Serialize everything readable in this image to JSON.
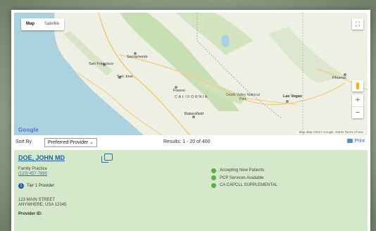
{
  "map": {
    "type_options": [
      "Map",
      "Satellite"
    ],
    "active_type": "Map",
    "logo": "Google",
    "attribution": "Map data ©2017 Google, INEGI    Terms of Use",
    "cities": [
      "Sacramento",
      "San Francisco",
      "San Jose",
      "Fresno",
      "CALIFORNIA",
      "Death Valley National Park",
      "Las Vegas",
      "Bakersfield",
      "Phoenix"
    ],
    "zoom_in": "+",
    "zoom_out": "−"
  },
  "toolbar": {
    "sort_label": "Sort By",
    "sort_value": "Preferred Provider",
    "results_text": "Results: 1 - 20 of 400",
    "print_label": "Print"
  },
  "provider": {
    "name": "DOE, JOHN MD",
    "specialty": "Family Practice",
    "phone": "(123) 457-7890",
    "tier": "Tier 1 Provider",
    "tier_icon": "1",
    "address_line1": "123 MAIN STREET",
    "address_line2": "ANYWHERE, USA 12345",
    "provider_id_label": "Provider ID:",
    "features": [
      "Accepting New Patients",
      "PCP Services Available",
      "CA CAPCLL SUPPLEMENTAL"
    ],
    "feature_color": "#55b04a"
  }
}
